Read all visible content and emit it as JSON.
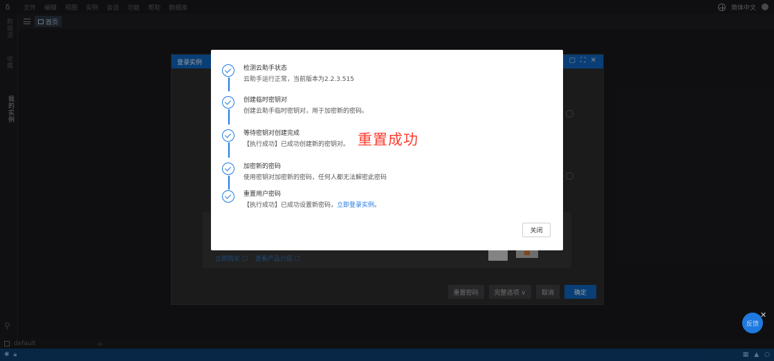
{
  "menubar": {
    "items": [
      "文件",
      "编辑",
      "视图",
      "实例",
      "会话",
      "功能",
      "帮助",
      "数据库"
    ],
    "language": "简体中文"
  },
  "leftbar": {
    "tabs": [
      "数据源",
      "收藏",
      "我的实例"
    ]
  },
  "tabbar": {
    "home": "首页"
  },
  "bottom": {
    "workspace": "default",
    "add": "+"
  },
  "bg_dialog": {
    "title": "登录实例",
    "header_icons": "✕ ▢ ⛶ ✕",
    "links": [
      "立即购买 ☐",
      "查看产品介绍 ☐"
    ],
    "buttons": {
      "reset": "重置密码",
      "options": "完整选项 ∨",
      "cancel": "取消",
      "ok": "确定"
    }
  },
  "modal": {
    "steps": [
      {
        "title": "检测云助手状态",
        "desc": "云助手运行正常，当前版本为2.2.3.515"
      },
      {
        "title": "创建临时密钥对",
        "desc": "创建云助手临时密钥对，用于加密新的密码。"
      },
      {
        "title": "等待密钥对创建完成",
        "desc": "【执行成功】已成功创建新的密钥对。"
      },
      {
        "title": "加密新的密码",
        "desc": "使用密钥对加密新的密码，任何人都无法解密此密码"
      },
      {
        "title": "重置用户密码",
        "desc": "【执行成功】已成功设置新密码，",
        "link": "立即登录实例",
        "tail": "。"
      }
    ],
    "success_text": "重置成功",
    "close_label": "关闭"
  },
  "fab": {
    "label": "反馈"
  },
  "colors": {
    "accent": "#1f7ae0",
    "success_text": "#ff3b2f",
    "statusbar": "#0d3c6b"
  }
}
